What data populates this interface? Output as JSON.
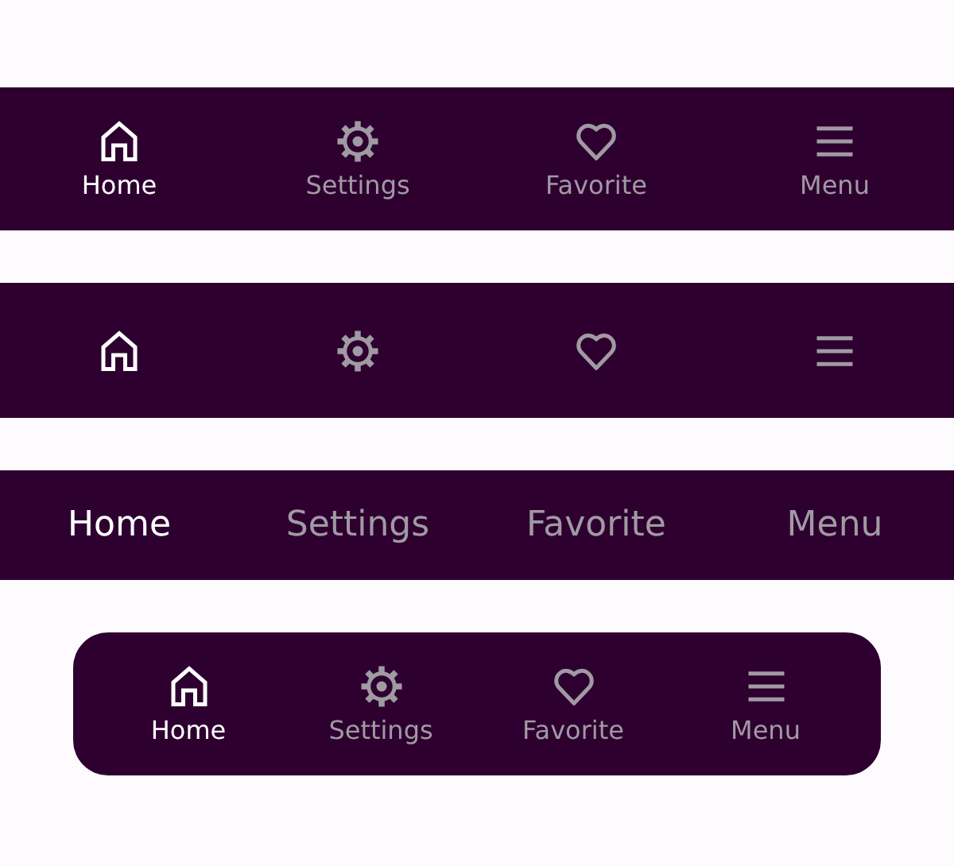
{
  "navbars": [
    {
      "kind": "icon_label",
      "items": [
        {
          "kind": "home",
          "label": "Home",
          "selected": true
        },
        {
          "kind": "gear",
          "label": "Settings",
          "selected": false
        },
        {
          "kind": "heart",
          "label": "Favorite",
          "selected": false
        },
        {
          "kind": "menu",
          "label": "Menu",
          "selected": false
        }
      ]
    },
    {
      "kind": "icon_only",
      "items": [
        {
          "kind": "home",
          "selected": true
        },
        {
          "kind": "gear",
          "selected": false
        },
        {
          "kind": "heart",
          "selected": false
        },
        {
          "kind": "menu",
          "selected": false
        }
      ]
    },
    {
      "kind": "label_only",
      "items": [
        {
          "label": "Home",
          "selected": true
        },
        {
          "label": "Settings",
          "selected": false
        },
        {
          "label": "Favorite",
          "selected": false
        },
        {
          "label": "Menu",
          "selected": false
        }
      ]
    },
    {
      "kind": "floating",
      "items": [
        {
          "kind": "home",
          "label": "Home",
          "selected": true
        },
        {
          "kind": "gear",
          "label": "Settings",
          "selected": false
        },
        {
          "kind": "heart",
          "label": "Favorite",
          "selected": false
        },
        {
          "kind": "menu",
          "label": "Menu",
          "selected": false
        }
      ]
    }
  ]
}
